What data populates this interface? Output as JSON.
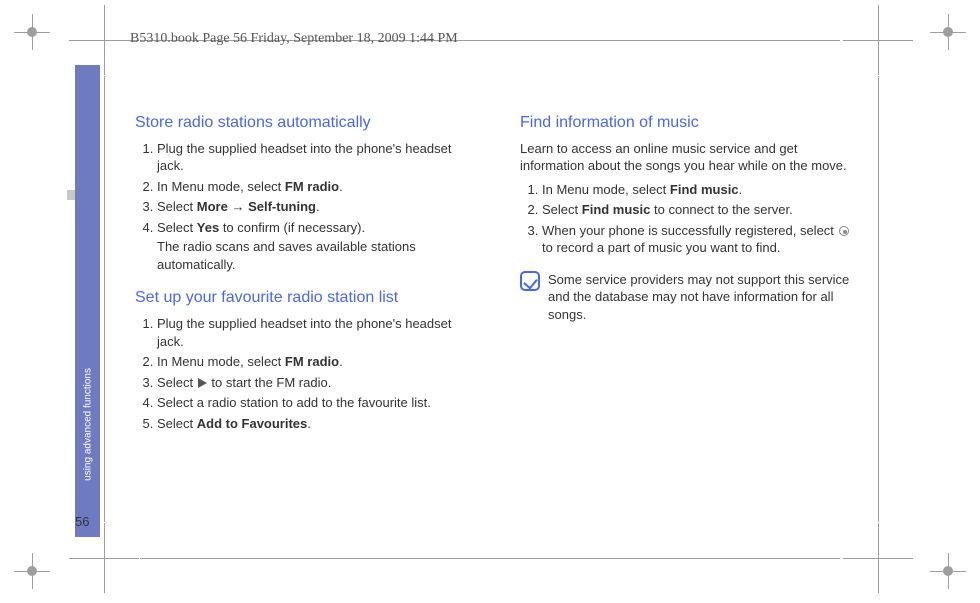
{
  "header": {
    "slug": "B5310.book  Page 56  Friday, September 18, 2009  1:44 PM"
  },
  "sidebar": {
    "label": "using advanced functions"
  },
  "footer": {
    "page_number": "56"
  },
  "left": {
    "section1": {
      "title": "Store radio stations automatically",
      "steps": [
        "Plug the supplied headset into the phone's headset jack.",
        {
          "pre": "In Menu mode, select",
          "bold": "FM radio",
          "post": "."
        },
        {
          "pre": "Select",
          "bold1": "More",
          "arrow": "→",
          "bold2": "Self-tuning",
          "post": "."
        },
        {
          "pre": "Select",
          "bold": "Yes",
          "post": "to confirm (if necessary).",
          "sub": "The radio scans and saves available stations automatically."
        }
      ]
    },
    "section2": {
      "title": "Set up your favourite radio station list",
      "steps": [
        "Plug the supplied headset into the phone's headset jack.",
        {
          "pre": "In Menu mode, select",
          "bold": "FM radio",
          "post": "."
        },
        {
          "pre": "Select",
          "post": "to start the FM radio."
        },
        "Select a radio station to add to the favourite list.",
        {
          "pre": "Select",
          "bold": "Add to Favourites",
          "post": "."
        }
      ]
    }
  },
  "right": {
    "section1": {
      "title": "Find information of music",
      "intro": "Learn to access an online music service and get information about the songs you hear while on the move.",
      "steps": [
        {
          "pre": "In Menu mode, select",
          "bold": "Find music",
          "post": "."
        },
        {
          "pre": "Select",
          "bold": "Find music",
          "post": "to connect to the server."
        },
        {
          "pre": "When your phone is successfully registered, select",
          "post": "to record a part of music you want to find."
        }
      ],
      "note": "Some service providers may not support this service and the database may not have information for all songs."
    }
  }
}
